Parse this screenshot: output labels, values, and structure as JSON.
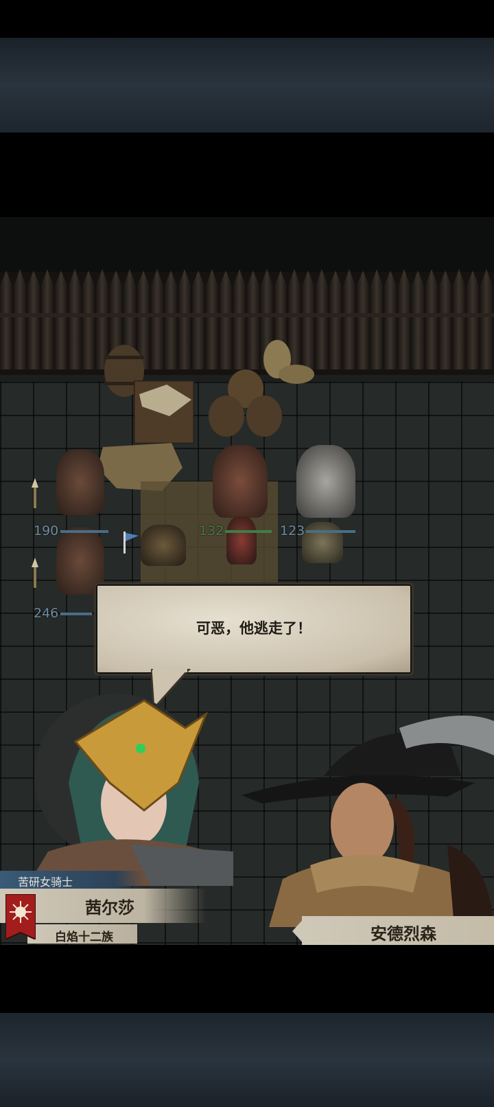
{
  "battle": {
    "units": [
      {
        "hp": "190"
      },
      {
        "hp": "132"
      },
      {
        "hp": "123"
      },
      {
        "hp": "246"
      }
    ]
  },
  "dialogue": {
    "text": "可恶，他逃走了！"
  },
  "speaker_left": {
    "title": "苦研女骑士",
    "name": "茜尔莎",
    "clan": "白焰十二族"
  },
  "speaker_right": {
    "name": "安德烈森"
  },
  "colors": {
    "hp_blue": "#6f8da0",
    "hp_green": "#4b7a4a",
    "title_strip": "#3a5a77",
    "banner_red": "#a31d1d",
    "parchment": "#d8cfbd"
  }
}
